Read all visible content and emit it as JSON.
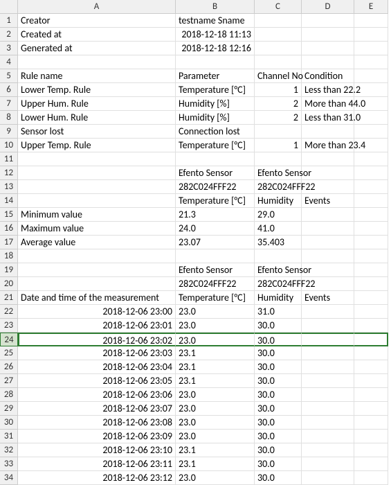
{
  "columns": [
    "A",
    "B",
    "C",
    "D",
    "E"
  ],
  "selected_row": 24,
  "visible_rows": 34,
  "cells": {
    "1": {
      "A": "Creator",
      "B": "testname Sname"
    },
    "2": {
      "A": "Created at",
      "B": "2018-12-18 11:13",
      "B_align": "r"
    },
    "3": {
      "A": "Generated at",
      "B": "2018-12-18 12:16",
      "B_align": "r"
    },
    "5": {
      "A": "Rule name",
      "B": "Parameter",
      "C": "Channel No",
      "D": "Condition"
    },
    "6": {
      "A": "Lower Temp. Rule",
      "B": "Temperature  [°C]",
      "C": "1",
      "C_align": "r",
      "D": "Less than 22.2"
    },
    "7": {
      "A": "Upper Hum. Rule",
      "B": "Humidity  [%]",
      "C": "2",
      "C_align": "r",
      "D": "More than 44.0"
    },
    "8": {
      "A": "Lower Hum. Rule",
      "B": "Humidity  [%]",
      "C": "2",
      "C_align": "r",
      "D": "Less than 31.0"
    },
    "9": {
      "A": "Sensor lost",
      "B": "Connection lost"
    },
    "10": {
      "A": "Upper Temp. Rule",
      "B": "Temperature  [°C]",
      "C": "1",
      "C_align": "r",
      "D": "More than 23.4"
    },
    "12": {
      "B": "Efento Sensor",
      "C": "Efento Sensor"
    },
    "13": {
      "B": "282C024FFF22",
      "C": "282C024FFF22"
    },
    "14": {
      "B": "Temperature [°C]",
      "C": "Humidity",
      "D": "Events"
    },
    "15": {
      "A": "Minimum value",
      "B": "21.3",
      "C": "29.0"
    },
    "16": {
      "A": "Maximum value",
      "B": "24.0",
      "C": "41.0"
    },
    "17": {
      "A": "Average value",
      "B": "23.07",
      "C": "35.403"
    },
    "19": {
      "B": "Efento Sensor",
      "C": "Efento Sensor"
    },
    "20": {
      "B": "282C024FFF22",
      "C": "282C024FFF22"
    },
    "21": {
      "A": "Date and time of the measurement",
      "B": "Temperature [°C]",
      "C": "Humidity",
      "D": "Events"
    },
    "22": {
      "A": "2018-12-06 23:00",
      "A_align": "r",
      "B": "23.0",
      "C": "31.0"
    },
    "23": {
      "A": "2018-12-06 23:01",
      "A_align": "r",
      "B": "23.0",
      "C": "30.0"
    },
    "24": {
      "A": "2018-12-06 23:02",
      "A_align": "r",
      "B": "23.0",
      "C": "30.0"
    },
    "25": {
      "A": "2018-12-06 23:03",
      "A_align": "r",
      "B": "23.1",
      "C": "30.0"
    },
    "26": {
      "A": "2018-12-06 23:04",
      "A_align": "r",
      "B": "23.1",
      "C": "30.0"
    },
    "27": {
      "A": "2018-12-06 23:05",
      "A_align": "r",
      "B": "23.1",
      "C": "30.0"
    },
    "28": {
      "A": "2018-12-06 23:06",
      "A_align": "r",
      "B": "23.0",
      "C": "30.0"
    },
    "29": {
      "A": "2018-12-06 23:07",
      "A_align": "r",
      "B": "23.0",
      "C": "30.0"
    },
    "30": {
      "A": "2018-12-06 23:08",
      "A_align": "r",
      "B": "23.0",
      "C": "30.0"
    },
    "31": {
      "A": "2018-12-06 23:09",
      "A_align": "r",
      "B": "23.0",
      "C": "30.0"
    },
    "32": {
      "A": "2018-12-06 23:10",
      "A_align": "r",
      "B": "23.1",
      "C": "30.0"
    },
    "33": {
      "A": "2018-12-06 23:11",
      "A_align": "r",
      "B": "23.1",
      "C": "30.0"
    },
    "34": {
      "A": "2018-12-06 23:12",
      "A_align": "r",
      "B": "23.0",
      "C": "30.0"
    }
  },
  "overflow_cells": [
    {
      "row": 5,
      "col": "C"
    },
    {
      "row": 6,
      "col": "D"
    },
    {
      "row": 7,
      "col": "D"
    },
    {
      "row": 8,
      "col": "D"
    },
    {
      "row": 10,
      "col": "D"
    },
    {
      "row": 12,
      "col": "C"
    },
    {
      "row": 13,
      "col": "C"
    },
    {
      "row": 19,
      "col": "C"
    },
    {
      "row": 20,
      "col": "C"
    },
    {
      "row": 21,
      "col": "A"
    }
  ]
}
